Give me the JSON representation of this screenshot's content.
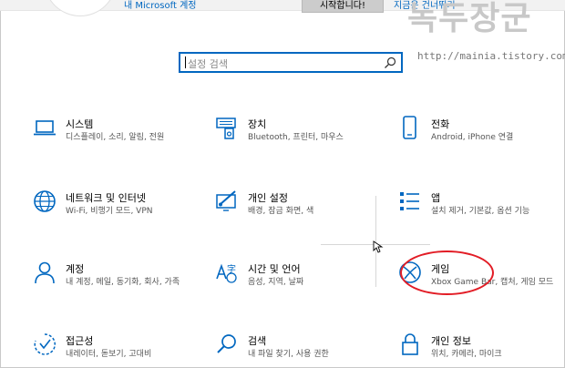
{
  "header": {
    "account_link": "내 Microsoft 계정",
    "start_button": "시작합니다!",
    "top_link": "지금은 건너뛰기"
  },
  "watermark": {
    "title": "녹두장군",
    "url": "http://mainia.tistory.com"
  },
  "search": {
    "placeholder": "설정 검색"
  },
  "accent_color": "#0067c0",
  "highlight_color": "#e21c25",
  "tiles": [
    {
      "title": "시스템",
      "desc": "디스플레이, 소리, 알림, 전원",
      "icon": "laptop-icon"
    },
    {
      "title": "장치",
      "desc": "Bluetooth, 프린터, 마우스",
      "icon": "devices-icon"
    },
    {
      "title": "전화",
      "desc": "Android, iPhone 연결",
      "icon": "phone-icon"
    },
    {
      "title": "네트워크 및 인터넷",
      "desc": "Wi-Fi, 비행기 모드, VPN",
      "icon": "globe-icon"
    },
    {
      "title": "개인 설정",
      "desc": "배경, 잠금 화면, 색",
      "icon": "personalization-icon"
    },
    {
      "title": "앱",
      "desc": "설치 제거, 기본값, 옵션 기능",
      "icon": "apps-icon"
    },
    {
      "title": "계정",
      "desc": "내 계정, 메일, 동기화, 회사, 가족",
      "icon": "person-icon"
    },
    {
      "title": "시간 및 언어",
      "desc": "음성, 지역, 날짜",
      "icon": "time-language-icon"
    },
    {
      "title": "게임",
      "desc": "Xbox Game Bar, 캡처, 게임 모드",
      "icon": "xbox-icon"
    },
    {
      "title": "접근성",
      "desc": "내레이터, 돋보기, 고대비",
      "icon": "accessibility-icon"
    },
    {
      "title": "검색",
      "desc": "내 파일 찾기, 사용 권한",
      "icon": "search-icon"
    },
    {
      "title": "개인 정보",
      "desc": "위치, 카메라, 마이크",
      "icon": "lock-icon"
    }
  ]
}
